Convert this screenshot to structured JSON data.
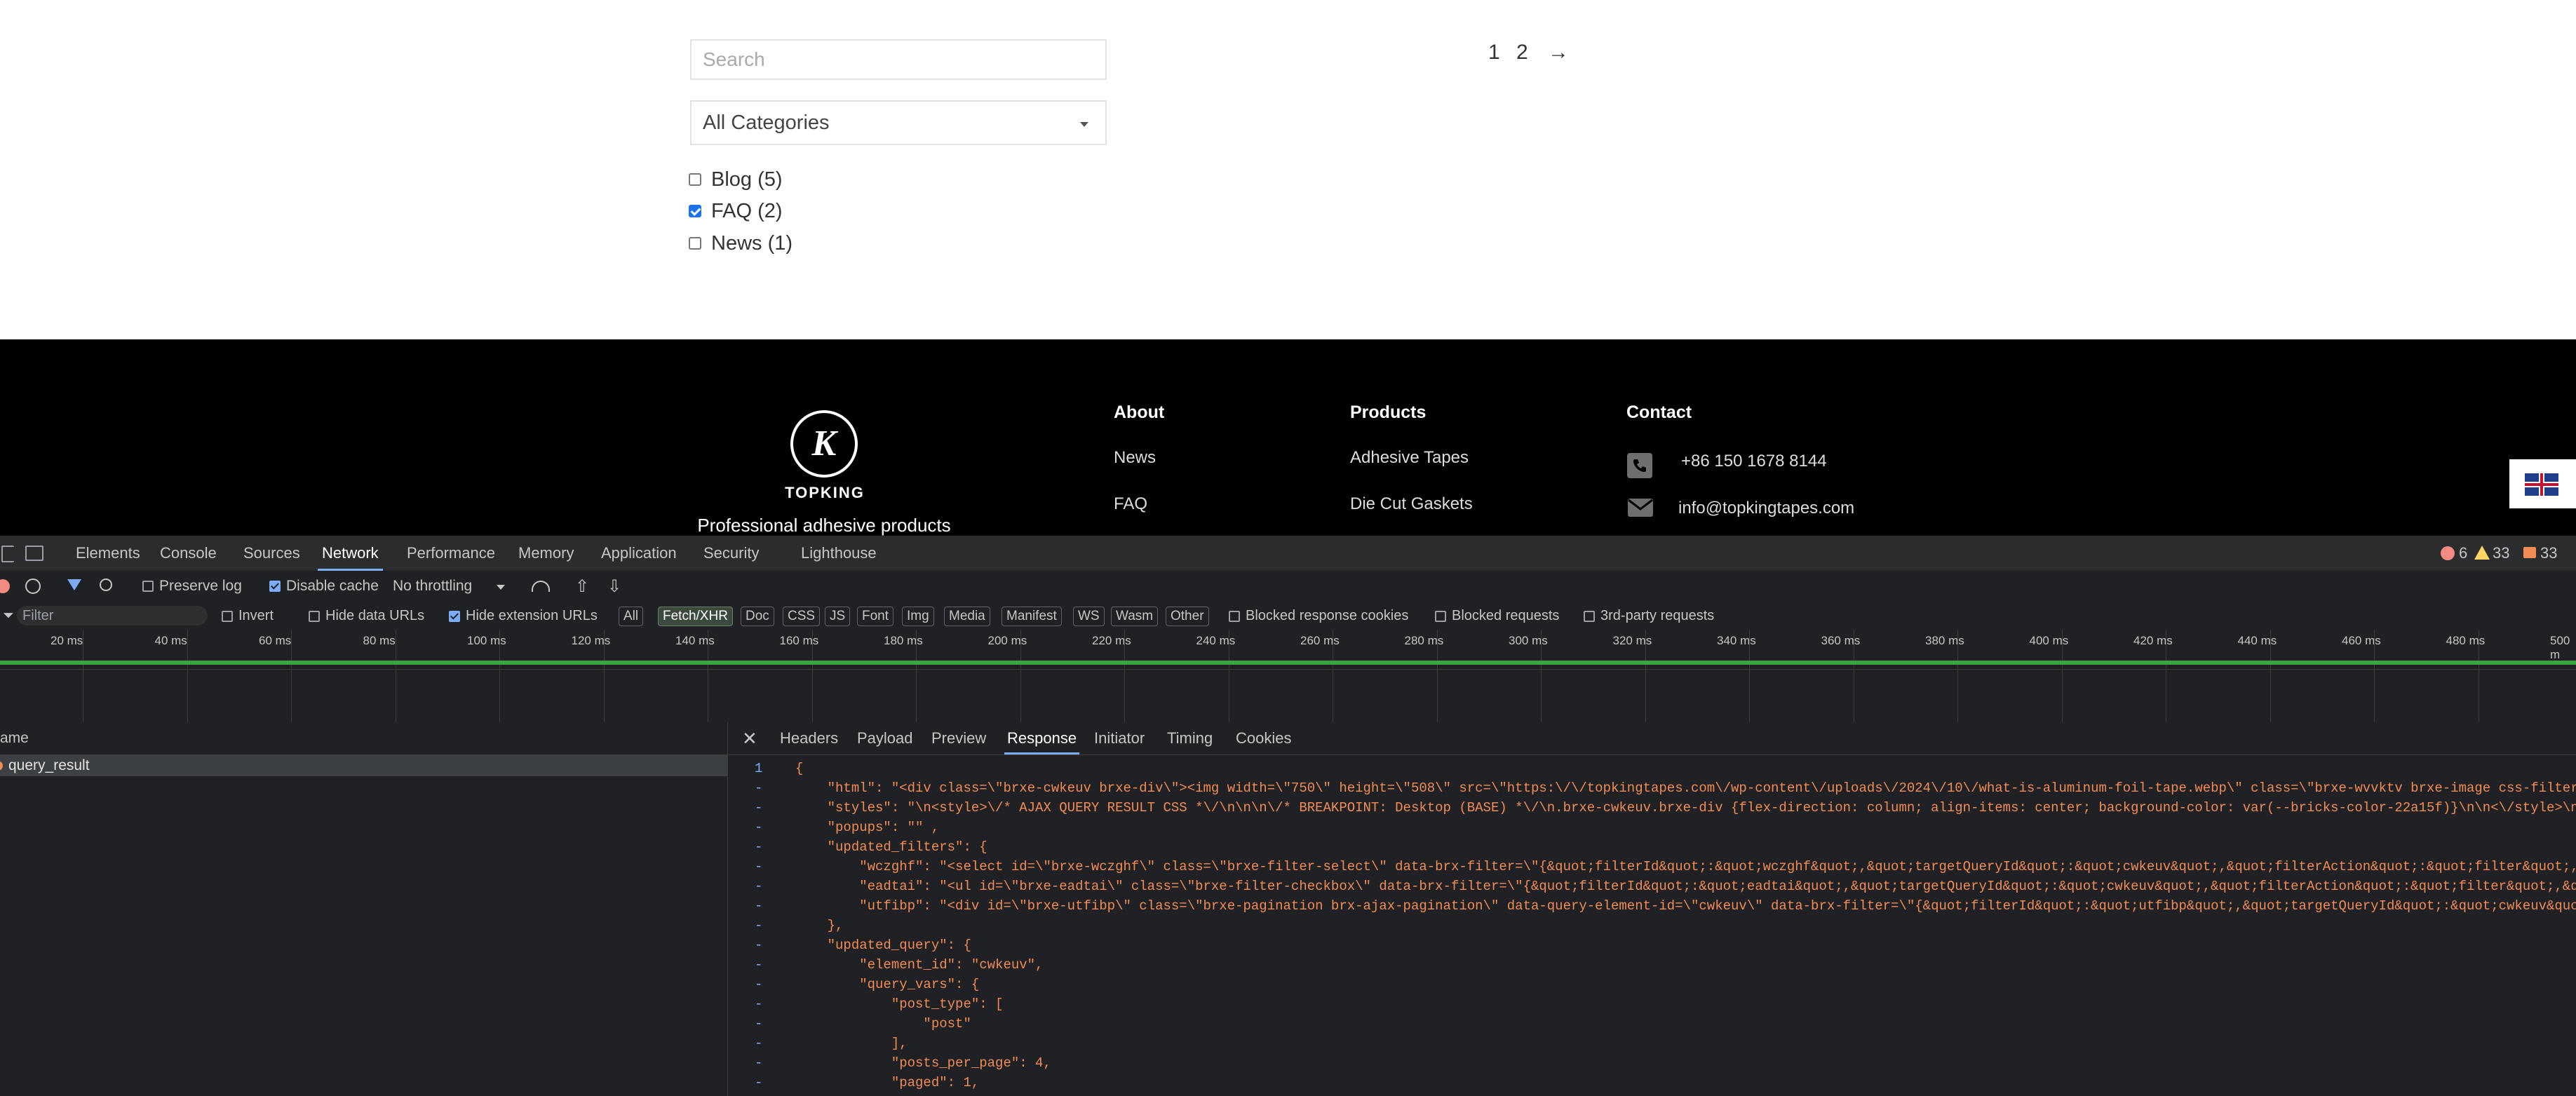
{
  "page": {
    "search_placeholder": "Search",
    "category_select": "All Categories",
    "categories": [
      {
        "label": "Blog (5)",
        "checked": false
      },
      {
        "label": "FAQ (2)",
        "checked": true
      },
      {
        "label": "News (1)",
        "checked": false
      }
    ],
    "pagination": [
      "1",
      "2",
      "→"
    ]
  },
  "footer": {
    "logo_letter": "K",
    "logo_word": "TOPKING",
    "tagline": "Professional adhesive products",
    "about": {
      "heading": "About",
      "links": [
        "News",
        "FAQ"
      ]
    },
    "products": {
      "heading": "Products",
      "links": [
        "Adhesive Tapes",
        "Die Cut Gaskets"
      ]
    },
    "contact": {
      "heading": "Contact",
      "phone": "+86 150 1678 8144",
      "email": "info@topkingtapes.com"
    }
  },
  "devtools": {
    "tabs": [
      "Elements",
      "Console",
      "Sources",
      "Network",
      "Performance",
      "Memory",
      "Application",
      "Security",
      "Lighthouse"
    ],
    "active_tab": "Network",
    "counters": {
      "errors": "6",
      "warnings": "33",
      "issues": "33"
    },
    "toolbar": {
      "preserve_log": "Preserve log",
      "disable_cache": "Disable cache",
      "throttling": "No throttling"
    },
    "filterbar": {
      "filter_placeholder": "Filter",
      "invert": "Invert",
      "hide_data_urls": "Hide data URLs",
      "hide_extension_urls": "Hide extension URLs",
      "types": [
        "All",
        "Fetch/XHR",
        "Doc",
        "CSS",
        "JS",
        "Font",
        "Img",
        "Media",
        "Manifest",
        "WS",
        "Wasm",
        "Other"
      ],
      "active_type": "Fetch/XHR",
      "blocked_cookies": "Blocked response cookies",
      "blocked_requests": "Blocked requests",
      "third_party": "3rd-party requests"
    },
    "timeline_ticks": [
      "20 ms",
      "40 ms",
      "60 ms",
      "80 ms",
      "100 ms",
      "120 ms",
      "140 ms",
      "160 ms",
      "180 ms",
      "200 ms",
      "220 ms",
      "240 ms",
      "260 ms",
      "280 ms",
      "300 ms",
      "320 ms",
      "340 ms",
      "360 ms",
      "380 ms",
      "400 ms",
      "420 ms",
      "440 ms",
      "460 ms",
      "480 ms",
      "500 m"
    ],
    "request_list": {
      "header": "ame",
      "rows": [
        "query_result"
      ]
    },
    "detail_tabs": [
      "Headers",
      "Payload",
      "Preview",
      "Response",
      "Initiator",
      "Timing",
      "Cookies"
    ],
    "active_detail_tab": "Response",
    "response_lines": [
      {
        "gutter": "1",
        "text": "{"
      },
      {
        "gutter": "-",
        "text": "    \"html\": \"<div class=\\\"brxe-cwkeuv brxe-div\\\"><img width=\\\"750\\\" height=\\\"508\\\" src=\\\"https:\\/\\/topkingtapes.com\\/wp-content\\/uploads\\/2024\\/10\\/what-is-aluminum-foil-tape.webp\\\" class=\\\"brxe-wvvktv brxe-image css-filter size-larg"
      },
      {
        "gutter": "-",
        "text": "    \"styles\": \"\\n<style>\\/* AJAX QUERY RESULT CSS *\\/\\n\\n\\n\\/* BREAKPOINT: Desktop (BASE) *\\/\\n.brxe-cwkeuv.brxe-div {flex-direction: column; align-items: center; background-color: var(--bricks-color-22a15f)}\\n\\n<\\/style>\\n\","
      },
      {
        "gutter": "-",
        "text": "    \"popups\": \"\" ,"
      },
      {
        "gutter": "-",
        "text": "    \"updated_filters\": {"
      },
      {
        "gutter": "-",
        "text": "        \"wczghf\": \"<select id=\\\"brxe-wczghf\\\" class=\\\"brxe-filter-select\\\" data-brx-filter=\\\"{&quot;filterId&quot;:&quot;wczghf&quot;,&quot;targetQueryId&quot;:&quot;cwkeuv&quot;,&quot;filterAction&quot;:&quot;filter&quot;,&quot;filt"
      },
      {
        "gutter": "-",
        "text": "        \"eadtai\": \"<ul id=\\\"brxe-eadtai\\\" class=\\\"brxe-filter-checkbox\\\" data-brx-filter=\\\"{&quot;filterId&quot;:&quot;eadtai&quot;,&quot;targetQueryId&quot;:&quot;cwkeuv&quot;,&quot;filterAction&quot;:&quot;filter&quot;,&quot;filter"
      },
      {
        "gutter": "-",
        "text": "        \"utfibp\": \"<div id=\\\"brxe-utfibp\\\" class=\\\"brxe-pagination brx-ajax-pagination\\\" data-query-element-id=\\\"cwkeuv\\\" data-brx-filter=\\\"{&quot;filterId&quot;:&quot;utfibp&quot;,&quot;targetQueryId&quot;:&quot;cwkeuv&quot;,&quot;f"
      },
      {
        "gutter": "-",
        "text": "    },"
      },
      {
        "gutter": "-",
        "text": "    \"updated_query\": {"
      },
      {
        "gutter": "-",
        "text": "        \"element_id\": \"cwkeuv\","
      },
      {
        "gutter": "-",
        "text": "        \"query_vars\": {"
      },
      {
        "gutter": "-",
        "text": "            \"post_type\": ["
      },
      {
        "gutter": "-",
        "text": "                \"post\""
      },
      {
        "gutter": "-",
        "text": "            ],"
      },
      {
        "gutter": "-",
        "text": "            \"posts_per_page\": 4,"
      },
      {
        "gutter": "-",
        "text": "            \"paged\": 1,"
      }
    ]
  }
}
